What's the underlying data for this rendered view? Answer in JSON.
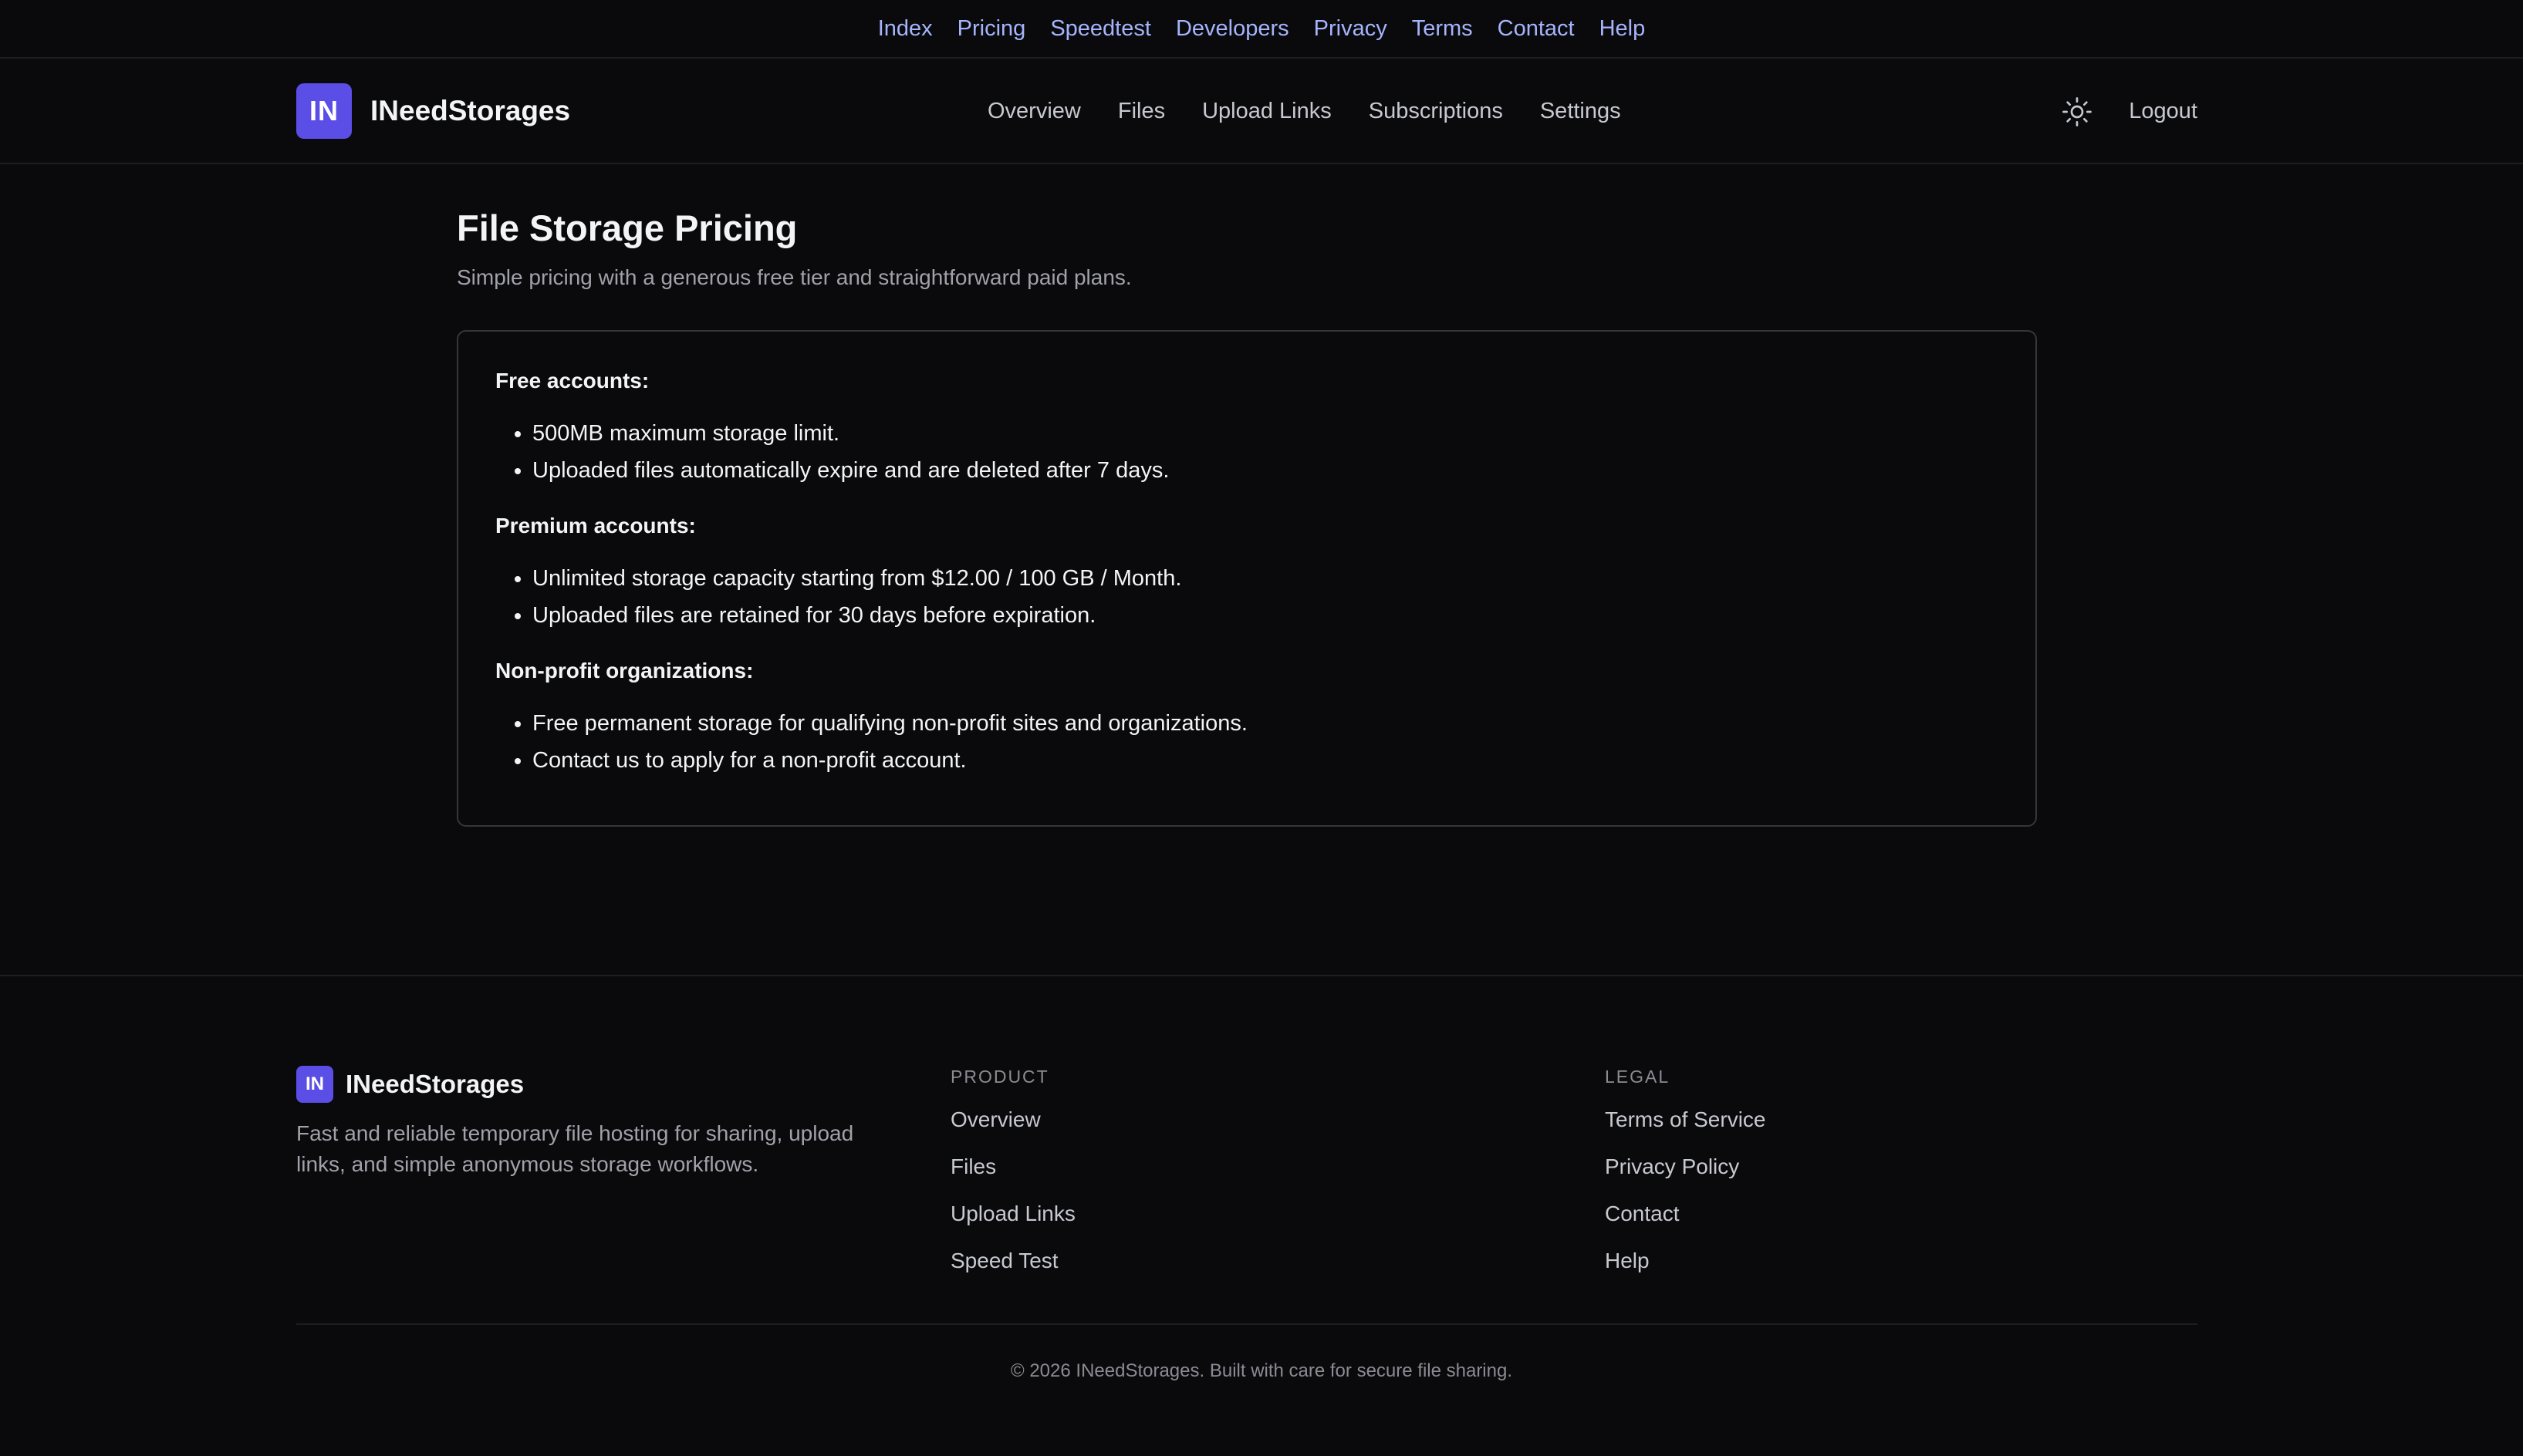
{
  "topbar": {
    "links": [
      "Index",
      "Pricing",
      "Speedtest",
      "Developers",
      "Privacy",
      "Terms",
      "Contact",
      "Help"
    ]
  },
  "header": {
    "logo_text": "IN",
    "brand": "INeedStorages",
    "nav": [
      "Overview",
      "Files",
      "Upload Links",
      "Subscriptions",
      "Settings"
    ],
    "theme_icon": "sun-icon",
    "logout": "Logout"
  },
  "main": {
    "title": "File Storage Pricing",
    "subtitle": "Simple pricing with a generous free tier and straightforward paid plans.",
    "sections": [
      {
        "title": "Free accounts:",
        "items": [
          "500MB maximum storage limit.",
          "Uploaded files automatically expire and are deleted after 7 days."
        ]
      },
      {
        "title": "Premium accounts:",
        "items": [
          "Unlimited storage capacity starting from $12.00 / 100 GB / Month.",
          "Uploaded files are retained for 30 days before expiration."
        ]
      },
      {
        "title": "Non-profit organizations:",
        "items": [
          "Free permanent storage for qualifying non-profit sites and organizations.",
          "Contact us to apply for a non-profit account."
        ]
      }
    ]
  },
  "footer": {
    "logo_text": "IN",
    "brand": "INeedStorages",
    "description": "Fast and reliable temporary file hosting for sharing, upload links, and simple anonymous storage workflows.",
    "product": {
      "heading": "PRODUCT",
      "links": [
        "Overview",
        "Files",
        "Upload Links",
        "Speed Test"
      ]
    },
    "legal": {
      "heading": "LEGAL",
      "links": [
        "Terms of Service",
        "Privacy Policy",
        "Contact",
        "Help"
      ]
    },
    "copyright": "© 2026 INeedStorages. Built with care for secure file sharing."
  },
  "colors": {
    "background": "#0a0a0c",
    "accent": "#5b4ee6",
    "top_link": "#a5b4fc",
    "border": "#35353d"
  }
}
